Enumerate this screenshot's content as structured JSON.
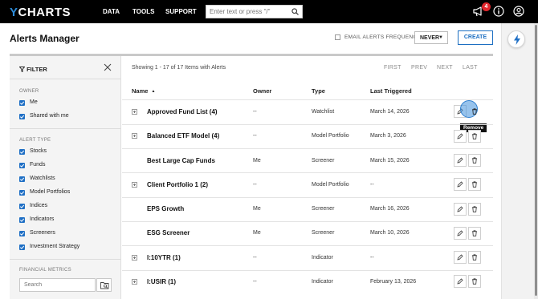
{
  "nav": {
    "logo_prefix": "Y",
    "logo_rest": "CHARTS",
    "links": [
      "DATA",
      "TOOLS",
      "SUPPORT"
    ],
    "search_placeholder": "Enter text or press \"/\"",
    "notification_count": "4"
  },
  "header": {
    "title": "Alerts Manager",
    "email_label": "EMAIL ALERTS FREQUENCY:",
    "frequency": "NEVER",
    "create_label": "CREATE"
  },
  "filter": {
    "title": "FILTER",
    "owner_heading": "OWNER",
    "owner_items": [
      "Me",
      "Shared with me"
    ],
    "alert_type_heading": "ALERT TYPE",
    "alert_types": [
      "Stocks",
      "Funds",
      "Watchlists",
      "Model Portfolios",
      "Indices",
      "Indicators",
      "Screeners",
      "Investment Strategy"
    ],
    "metrics_heading": "FINANCIAL METRICS",
    "search_placeholder": "Search"
  },
  "table": {
    "showing": "Showing 1 - 17 of 17 Items with Alerts",
    "pager": {
      "first": "FIRST",
      "prev": "PREV",
      "next": "NEXT",
      "last": "LAST"
    },
    "columns": {
      "name": "Name",
      "owner": "Owner",
      "type": "Type",
      "last": "Last Triggered"
    },
    "rows": [
      {
        "name": "Approved Fund List (4)",
        "owner": "--",
        "type": "Watchlist",
        "last": "March 14, 2026",
        "expandable": true
      },
      {
        "name": "Balanced ETF Model (4)",
        "owner": "--",
        "type": "Model Portfolio",
        "last": "March 3, 2026",
        "expandable": true
      },
      {
        "name": "Best Large Cap Funds",
        "owner": "Me",
        "type": "Screener",
        "last": "March 15, 2026",
        "expandable": false
      },
      {
        "name": "Client Portfolio 1 (2)",
        "owner": "--",
        "type": "Model Portfolio",
        "last": "--",
        "expandable": true
      },
      {
        "name": "EPS Growth",
        "owner": "Me",
        "type": "Screener",
        "last": "March 16, 2026",
        "expandable": false
      },
      {
        "name": "ESG Screener",
        "owner": "Me",
        "type": "Screener",
        "last": "March 10, 2026",
        "expandable": false
      },
      {
        "name": "I:10YTR (1)",
        "owner": "--",
        "type": "Indicator",
        "last": "--",
        "expandable": true
      },
      {
        "name": "I:USIR (1)",
        "owner": "--",
        "type": "Indicator",
        "last": "February 13, 2026",
        "expandable": true
      }
    ],
    "tooltip": "Remove"
  },
  "colors": {
    "accent": "#1f6fc5",
    "topbar": "#000000",
    "badge": "#e0262c"
  }
}
